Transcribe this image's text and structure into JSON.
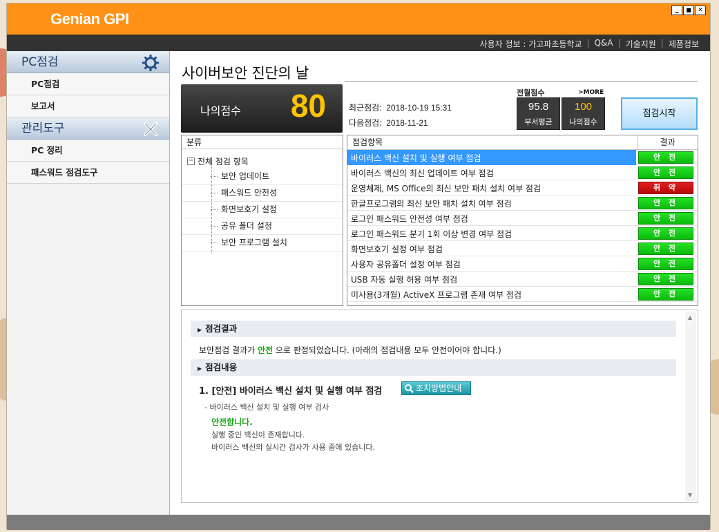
{
  "app": {
    "brand": "Genian GPI",
    "window_buttons": [
      "▁",
      "■",
      "✕"
    ]
  },
  "topnav": {
    "user_info": "사용자 정보 : 가고파초등학교",
    "qa": "Q&A",
    "support": "기술지원",
    "product": "제품정보"
  },
  "sidebar": {
    "pc_check_title": "PC점검",
    "pc_check_items": [
      "PC점검",
      "보고서"
    ],
    "mgmt_title": "관리도구",
    "mgmt_items": [
      "PC 정리",
      "패스워드 점검도구"
    ]
  },
  "main": {
    "page_title": "사이버보안 진단의 날",
    "score_label": "나의점수",
    "score_value": "80",
    "recent_label": "최근점검:",
    "recent_value": "2018-10-19 15:31",
    "next_label": "다음점검:",
    "next_value": "2018-11-21",
    "month_score_title": "전월점수",
    "more_link": ">MORE",
    "dept_avg_value": "95.8",
    "dept_avg_label": "부서평균",
    "my_score_value": "100",
    "my_score_label": "나의점수",
    "start_button": "점검시작"
  },
  "categories": {
    "header": "분류",
    "root": "전체 점검 항목",
    "root_toggle": "−",
    "items": [
      "보안 업데이트",
      "패스워드 안전성",
      "화면보호기 설정",
      "공유 폴더 설정",
      "보안 프로그램 설치"
    ]
  },
  "checks": {
    "header_item": "점검항목",
    "header_result": "결과",
    "rows": [
      {
        "name": "바이러스 백신 설치 및 실행 여부 점검",
        "result": "안 전",
        "status": "safe"
      },
      {
        "name": "바이러스 백신의 최신 업데이트 여부 점검",
        "result": "안 전",
        "status": "safe"
      },
      {
        "name": "운영체제, MS Office의 최신 보안 패치 설치 여부 점검",
        "result": "취 약",
        "status": "weak"
      },
      {
        "name": "한글프로그램의 최신 보안 패치 설치 여부 점검",
        "result": "안 전",
        "status": "safe"
      },
      {
        "name": "로그인 패스워드 안전성 여부 점검",
        "result": "안 전",
        "status": "safe"
      },
      {
        "name": "로그인 패스워드 분기 1회 이상 변경 여부 점검",
        "result": "안 전",
        "status": "safe"
      },
      {
        "name": "화면보호기 설정 여부 점검",
        "result": "안 전",
        "status": "safe"
      },
      {
        "name": "사용자 공유폴더 설정 여부 점검",
        "result": "안 전",
        "status": "safe"
      },
      {
        "name": "USB 자동 실행 허용 여부 점검",
        "result": "안 전",
        "status": "safe"
      },
      {
        "name": "미사용(3개월) ActiveX 프로그램 존재 여부 점검",
        "result": "안 전",
        "status": "safe"
      }
    ]
  },
  "result": {
    "section1_title": "점검결과",
    "text_before": "보안점검 결과가 ",
    "text_highlight": "안전",
    "text_after": " 으로 판정되었습니다. (아래의 점검내용 모두 안전이어야 합니다.)",
    "section2_title": "점검내용",
    "item_title": "1. [안전] 바이러스 백신 설치 및 실행 여부 점검",
    "guide_button": "조치방법안내",
    "detail_line": "- 바이러스 백신 설치 및 실행 여부 검사",
    "ok_text": "안전합니다.",
    "line1": "실행 중인 백신이 존재합니다.",
    "line2": "바이러스 백신의 실시간 검사가 사용 중에 있습니다."
  },
  "colors": {
    "brand_orange": "#ff9216",
    "safe_green": "#0cba0c",
    "weak_red": "#c80808",
    "score_yellow": "#ffc300",
    "selected_blue": "#3399ff"
  }
}
